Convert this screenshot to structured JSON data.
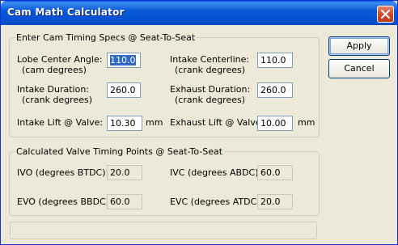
{
  "window": {
    "title": "Cam Math Calculator",
    "close_icon": "close-icon"
  },
  "input_group": {
    "legend": "Enter Cam Timing Specs @ Seat-To-Seat",
    "lobe_center": {
      "label_line1": "Lobe Center Angle:",
      "label_line2": "(cam degrees)",
      "value": "110.0"
    },
    "intake_centerline": {
      "label_line1": "Intake Centerline:",
      "label_line2": "(crank degrees)",
      "value": "110.0"
    },
    "intake_duration": {
      "label_line1": "Intake Duration:",
      "label_line2": "(crank degrees)",
      "value": "260.0"
    },
    "exhaust_duration": {
      "label_line1": "Exhaust Duration:",
      "label_line2": "(crank degrees)",
      "value": "260.0"
    },
    "intake_lift": {
      "label": "Intake Lift @ Valve:",
      "value": "10.30",
      "unit": "mm"
    },
    "exhaust_lift": {
      "label": "Exhaust Lift @ Valve:",
      "value": "10.00",
      "unit": "mm"
    }
  },
  "output_group": {
    "legend": "Calculated Valve Timing Points @ Seat-To-Seat",
    "ivo": {
      "label": "IVO (degrees BTDC):",
      "value": "20.0"
    },
    "ivc": {
      "label": "IVC (degrees ABDC):",
      "value": "60.0"
    },
    "evo": {
      "label": "EVO (degrees BBDC):",
      "value": "60.0"
    },
    "evc": {
      "label": "EVC (degrees ATDC):",
      "value": "20.0"
    }
  },
  "buttons": {
    "apply": "Apply",
    "cancel": "Cancel"
  },
  "status": {
    "text": ""
  }
}
